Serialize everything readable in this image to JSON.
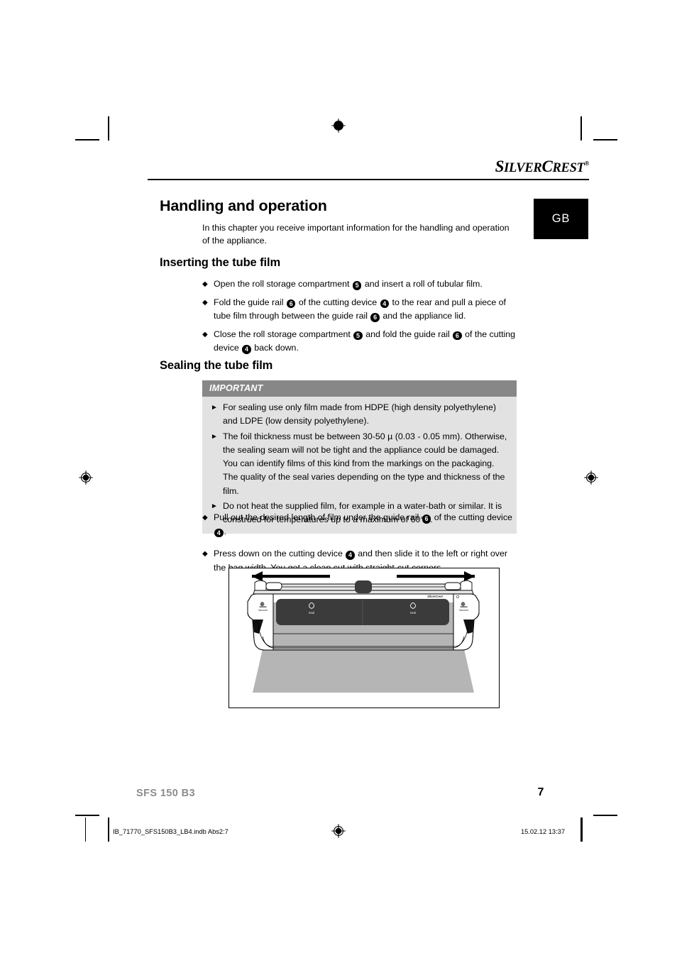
{
  "brand": {
    "name_parts": [
      "S",
      "ILVER",
      "C",
      "REST"
    ],
    "registered_symbol": "®"
  },
  "language_badge": {
    "label": "GB"
  },
  "sections": {
    "chapter_title": "Handling and operation",
    "chapter_intro": "In this chapter you receive important information for the handling and operation of the appliance.",
    "inserting": {
      "heading": "Inserting the tube film",
      "items": [
        {
          "parts": [
            "Open the roll storage compartment ",
            "5",
            " and insert a roll of tubular film."
          ]
        },
        {
          "parts": [
            "Fold the guide rail ",
            "6",
            " of the cutting device ",
            "4",
            " to the rear and pull a piece of tube film through between the guide rail ",
            "6",
            " and the appliance lid."
          ]
        },
        {
          "parts": [
            "Close the roll storage compartment ",
            "5",
            " and fold the guide rail ",
            "6",
            " of the cutting device ",
            "4",
            " back down."
          ]
        }
      ]
    },
    "sealing": {
      "heading": "Sealing the tube film",
      "notice": {
        "title": "IMPORTANT",
        "items": [
          "For sealing use only film made from HDPE (high density polyethylene) and LDPE (low density polyethylene).",
          "The foil thickness must be between 30-50 µ (0.03 - 0.05 mm). Otherwise, the sealing seam will not be tight and the appliance could be damaged. You can identify films of this kind from the markings on the packaging. The quality of the seal varies depending on the type and thickness of the film.",
          "Do not heat the supplied film, for example in a water-bath or similar. It is construed for temperatures up to a maximum of 60°C."
        ]
      },
      "items": [
        {
          "parts": [
            "Pull out the desired length of film under the guide rail ",
            "6",
            " of the cutting device ",
            "4",
            "."
          ]
        },
        {
          "parts": [
            "Press down on the cutting device ",
            "4",
            " and then slide it to the left or right over the bag width. You get a clean cut with straight-cut corners."
          ]
        }
      ]
    }
  },
  "figure": {
    "caption": "",
    "device_labels": {
      "left_vacuum": "Vacuum",
      "left_seal": "Seal",
      "right_seal": "Seal",
      "right_vacuum": "Vacuum",
      "lid_brand": "SilverCrest"
    },
    "arrow_left": "◄",
    "arrow_right": "►"
  },
  "footer": {
    "model": "SFS 150 B3",
    "page_number": "7",
    "print_file": "IB_71770_SFS150B3_LB4.indb   Abs2:7",
    "print_date": "15.02.12   13:37"
  },
  "colors": {
    "notice_header_bg": "#878787",
    "notice_body_bg": "#e2e2e2",
    "badge_bg": "#000000",
    "footer_model": "#8c8c8c",
    "film_gray": "#b5b5b5",
    "panel_dark": "#3b3b3b"
  }
}
